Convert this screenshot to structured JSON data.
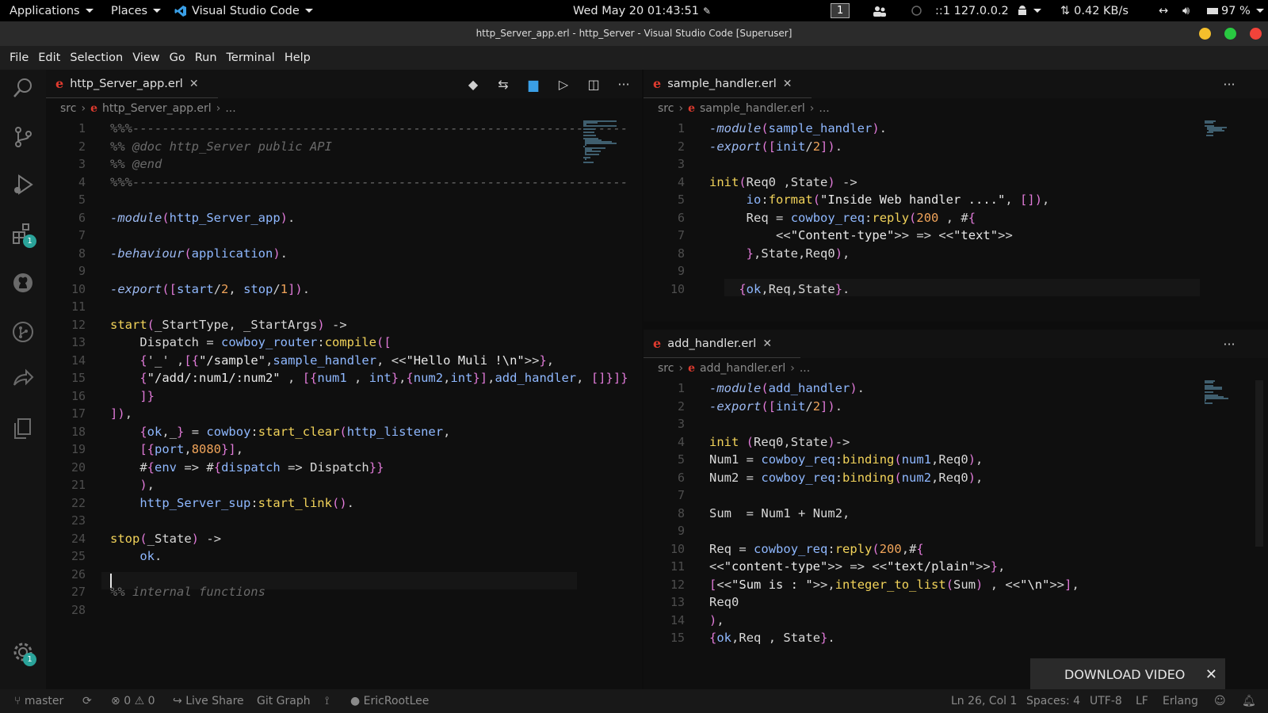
{
  "topbar": {
    "applications": "Applications",
    "places": "Places",
    "app_name": "Visual Studio Code",
    "clock": "Wed May 20  01:43:51",
    "workspace": "1",
    "net_ip": "::1 127.0.0.2",
    "net_speed": "0.42 KB/s",
    "battery": "97 %"
  },
  "window": {
    "title": "http_Server_app.erl - http_Server - Visual Studio Code [Superuser]",
    "btn_colors": [
      "#f4bf2c",
      "#29c941",
      "#f2433a"
    ]
  },
  "menu": [
    "File",
    "Edit",
    "Selection",
    "View",
    "Go",
    "Run",
    "Terminal",
    "Help"
  ],
  "activity": {
    "extensions_badge": "1",
    "settings_badge": "1"
  },
  "left": {
    "tab": "http_Server_app.erl",
    "crumb_root": "src",
    "crumb_file": "http_Server_app.erl",
    "crumb_tail": "...",
    "lines": [
      "%%%-------------------------------------------------------------------",
      "%% @doc http_Server public API",
      "%% @end",
      "%%%-------------------------------------------------------------------",
      "",
      "-module(http_Server_app).",
      "",
      "-behaviour(application).",
      "",
      "-export([start/2, stop/1]).",
      "",
      "start(_StartType, _StartArgs) ->",
      "    Dispatch = cowboy_router:compile([",
      "    {'_' ,[{\"/sample\",sample_handler, <<\"Hello Muli !\\n\">>},",
      "    {\"/add/:num1/:num2\" , [{num1 , int},{num2,int}],add_handler, []}]}",
      "    ]}",
      "]),",
      "    {ok,_} = cowboy:start_clear(http_listener,",
      "    [{port,8080}],",
      "    #{env => #{dispatch => Dispatch}}",
      "    ),",
      "    http_Server_sup:start_link().",
      "",
      "stop(_State) ->",
      "    ok.",
      "",
      "%% internal functions",
      ""
    ]
  },
  "right_top": {
    "tab": "sample_handler.erl",
    "crumb_root": "src",
    "crumb_file": "sample_handler.erl",
    "crumb_tail": "...",
    "lines": [
      "-module(sample_handler).",
      "-export([init/2]).",
      "",
      "init(Req0 ,State) ->",
      "     io:format(\"Inside Web handler ....\", []),",
      "     Req = cowboy_req:reply(200 , #{",
      "         <<\"Content-type\">> => <<\"text\">>",
      "     },State,Req0),",
      "",
      "    {ok,Req,State}."
    ]
  },
  "right_bottom": {
    "tab": "add_handler.erl",
    "crumb_root": "src",
    "crumb_file": "add_handler.erl",
    "crumb_tail": "...",
    "lines": [
      "-module(add_handler).",
      "-export([init/2]).",
      "",
      "init (Req0,State)->",
      "Num1 = cowboy_req:binding(num1,Req0),",
      "Num2 = cowboy_req:binding(num2,Req0),",
      "",
      "Sum  = Num1 + Num2,",
      "",
      "Req = cowboy_req:reply(200,#{",
      "<<\"content-type\">> => <<\"text/plain\">>},",
      "[<<\"Sum is : \">>,integer_to_list(Sum) , <<\"\\n\">>],",
      "Req0",
      "),",
      "{ok,Req , State}."
    ]
  },
  "status": {
    "branch": "master",
    "errors": "0",
    "warnings": "0",
    "live_share": "Live Share",
    "git_graph": "Git Graph",
    "user": "EricRootLee",
    "position": "Ln 26, Col 1",
    "spaces": "Spaces: 4",
    "encoding": "UTF-8",
    "eol": "LF",
    "language": "Erlang"
  },
  "download": {
    "label": "DOWNLOAD VIDEO"
  },
  "colors": {
    "keyword": "#9bb8f0",
    "function": "#f2d35a",
    "atom": "#8fb8ff",
    "string": "#e9e9e9",
    "number": "#f0a45a",
    "comment": "#6a6a6a",
    "bracket": "#e07ad8"
  }
}
